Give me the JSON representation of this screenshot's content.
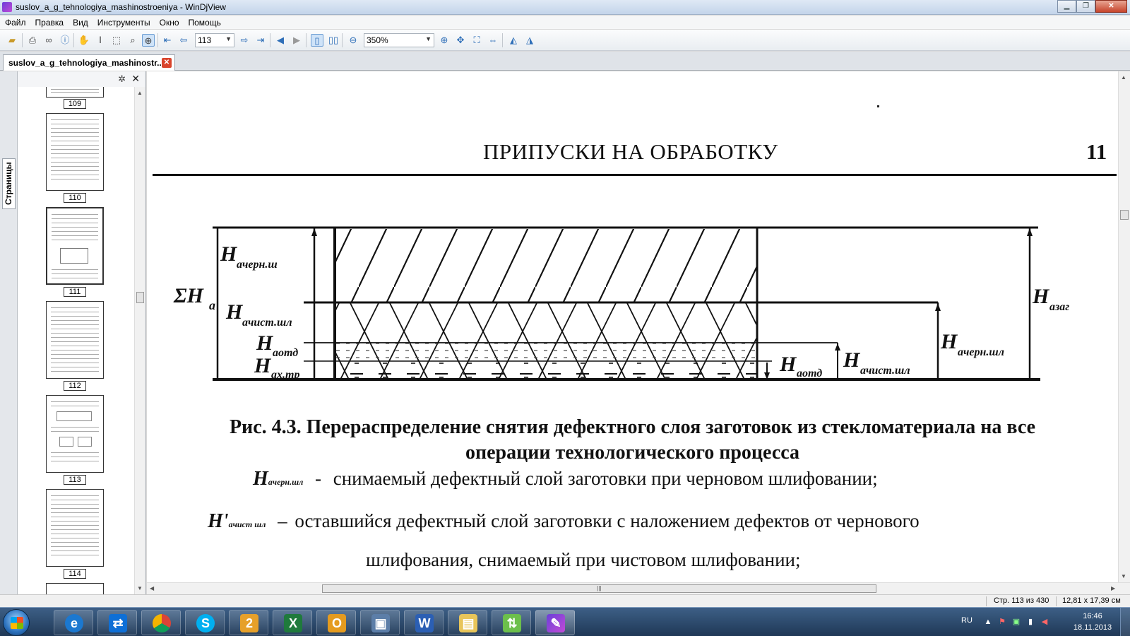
{
  "window": {
    "title": "suslov_a_g_tehnologiya_mashinostroeniya - WinDjView"
  },
  "menu": [
    "Файл",
    "Правка",
    "Вид",
    "Инструменты",
    "Окно",
    "Помощь"
  ],
  "toolbar": {
    "page_value": "113",
    "zoom_value": "350%"
  },
  "doc_tab": {
    "label": "suslov_a_g_tehnologiya_mashinostr..."
  },
  "side_panel": {
    "tab_label": "Страницы",
    "thumbnails": [
      {
        "page": "109"
      },
      {
        "page": "110"
      },
      {
        "page": "111"
      },
      {
        "page": "112"
      },
      {
        "page": "113"
      },
      {
        "page": "114"
      }
    ]
  },
  "document": {
    "heading": "ПРИПУСКИ НА ОБРАБОТКУ",
    "page_number_fragment": "11",
    "figure_labels": {
      "sum": "ΣH",
      "sum_sub": "a",
      "left_top": "H",
      "left_top_sub": "aчерн.ш",
      "left_mid": "H",
      "left_mid_sub": "aчист.шл",
      "left_otd": "H",
      "left_otd_sub": "aотд",
      "left_xtr": "H",
      "left_xtr_sub": "ax.тр",
      "right_otd": "H",
      "right_otd_sub": "aотд",
      "right_chist": "H",
      "right_chist_sub": "aчист.шл",
      "right_chern": "H",
      "right_chern_sub": "aчерн.шл",
      "right_zag": "H",
      "right_zag_sub": "aзаг"
    },
    "caption_line1": "Рис. 4.3. Перераспределение снятия дефектного слоя заготовок из стекломатериала на все",
    "caption_line2": "операции технологического процесса",
    "legend": [
      {
        "symbol": "H",
        "sub": "aчерн.шл",
        "dash": "-",
        "text": "снимаемый дефектный слой заготовки при черновом шлифовании;"
      },
      {
        "symbol": "H'",
        "sub": "aчист шл",
        "dash": "–",
        "text": "оставшийся дефектный слой заготовки с наложением дефектов от чернового"
      },
      {
        "text": "шлифования, снимаемый при чистовом шлифовании;"
      }
    ]
  },
  "status": {
    "page_info": "Стр. 113 из 430",
    "size_info": "12,81 x 17,39 см"
  },
  "taskbar": {
    "lang": "RU",
    "time": "16:46",
    "date": "18.11.2013"
  }
}
